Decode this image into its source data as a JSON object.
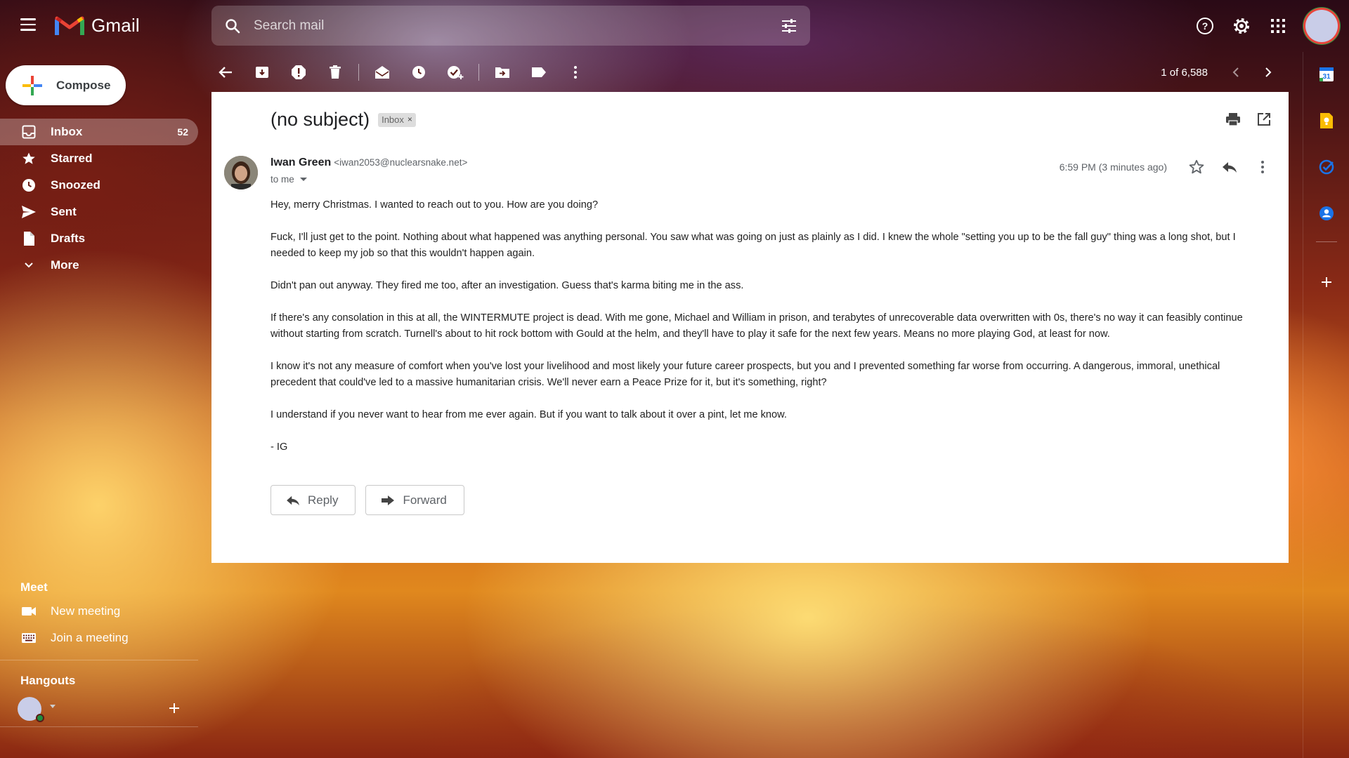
{
  "app": {
    "name": "Gmail"
  },
  "search": {
    "placeholder": "Search mail"
  },
  "compose": {
    "label": "Compose"
  },
  "sidebar": {
    "items": [
      {
        "label": "Inbox",
        "count": "52",
        "icon": "inbox-icon"
      },
      {
        "label": "Starred",
        "count": "",
        "icon": "star-icon"
      },
      {
        "label": "Snoozed",
        "count": "",
        "icon": "clock-icon"
      },
      {
        "label": "Sent",
        "count": "",
        "icon": "send-icon"
      },
      {
        "label": "Drafts",
        "count": "",
        "icon": "draft-icon"
      },
      {
        "label": "More",
        "count": "",
        "icon": "chevron-down-icon"
      }
    ]
  },
  "meet": {
    "title": "Meet",
    "items": [
      {
        "label": "New meeting",
        "icon": "video-icon"
      },
      {
        "label": "Join a meeting",
        "icon": "keyboard-icon"
      }
    ]
  },
  "hangouts": {
    "title": "Hangouts"
  },
  "toolbar": {
    "pager": "1 of 6,588"
  },
  "email": {
    "subject": "(no subject)",
    "label_chip": "Inbox",
    "sender_name": "Iwan Green",
    "sender_email": "<iwan2053@nuclearsnake.net>",
    "to": "to me",
    "timestamp": "6:59 PM (3 minutes ago)",
    "body": [
      "Hey, merry Christmas. I wanted to reach out to you. How are you doing?",
      "Fuck, I'll just get to the point. Nothing about what happened was anything personal. You saw what was going on just as plainly as I did. I knew the whole \"setting you up to be the fall guy\" thing was a long shot, but I needed to keep my job so that this wouldn't happen again.",
      "Didn't pan out anyway. They fired me too, after an investigation. Guess that's karma biting me in the ass.",
      "If there's any consolation in this at all, the WINTERMUTE project is dead. With me gone, Michael and William in prison, and terabytes of unrecoverable data overwritten with 0s, there's no way it can feasibly continue without starting from scratch. Turnell's about to hit rock bottom with Gould at the helm, and they'll have to play it safe for the next few years. Means no more playing God, at least for now.",
      "I know it's not any measure of comfort when you've lost your livelihood and most likely your future career prospects, but you and I prevented something far worse from occurring. A dangerous, immoral, unethical precedent that could've led to a massive humanitarian crisis. We'll never earn a Peace Prize for it, but it's something, right?",
      "I understand if you never want to hear from me ever again. But if you want to talk about it over a pint, let me know.",
      "- IG"
    ],
    "reply_label": "Reply",
    "forward_label": "Forward"
  },
  "colors": {
    "accent_blue": "#1a73e8",
    "gmail_red": "#ea4335",
    "gmail_yellow": "#fbbc04",
    "gmail_green": "#34a853",
    "panel_bg": "#ffffff"
  }
}
